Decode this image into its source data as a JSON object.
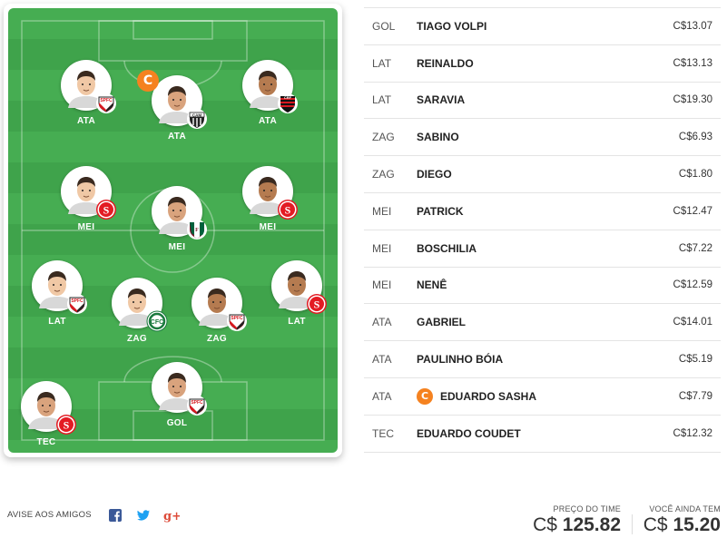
{
  "field": {
    "players": [
      {
        "id": "ata-left",
        "label": "ATA",
        "club": "spfc",
        "captain": false
      },
      {
        "id": "ata-center",
        "label": "ATA",
        "club": "cam",
        "captain": true,
        "captain_symbol": "C"
      },
      {
        "id": "ata-right",
        "label": "ATA",
        "club": "fla",
        "captain": false
      },
      {
        "id": "mei-left",
        "label": "MEI",
        "club": "inter",
        "captain": false
      },
      {
        "id": "mei-center",
        "label": "MEI",
        "club": "flu",
        "captain": false
      },
      {
        "id": "mei-right",
        "label": "MEI",
        "club": "inter",
        "captain": false
      },
      {
        "id": "lat-left",
        "label": "LAT",
        "club": "spfc",
        "captain": false
      },
      {
        "id": "zag-left",
        "label": "ZAG",
        "club": "cfc",
        "captain": false
      },
      {
        "id": "zag-right",
        "label": "ZAG",
        "club": "spfc",
        "captain": false
      },
      {
        "id": "lat-right",
        "label": "LAT",
        "club": "inter",
        "captain": false
      },
      {
        "id": "gol",
        "label": "GOL",
        "club": "spfc",
        "captain": false
      },
      {
        "id": "tec",
        "label": "TEC",
        "club": "inter",
        "captain": false
      }
    ]
  },
  "lineup": [
    {
      "pos": "GOL",
      "name": "TIAGO VOLPI",
      "price": "C$13.07"
    },
    {
      "pos": "LAT",
      "name": "REINALDO",
      "price": "C$13.13"
    },
    {
      "pos": "LAT",
      "name": "SARAVIA",
      "price": "C$19.30"
    },
    {
      "pos": "ZAG",
      "name": "SABINO",
      "price": "C$6.93"
    },
    {
      "pos": "ZAG",
      "name": "DIEGO",
      "price": "C$1.80"
    },
    {
      "pos": "MEI",
      "name": "PATRICK",
      "price": "C$12.47"
    },
    {
      "pos": "MEI",
      "name": "BOSCHILIA",
      "price": "C$7.22"
    },
    {
      "pos": "MEI",
      "name": "NENÊ",
      "price": "C$12.59"
    },
    {
      "pos": "ATA",
      "name": "GABRIEL",
      "price": "C$14.01"
    },
    {
      "pos": "ATA",
      "name": "PAULINHO BÓIA",
      "price": "C$5.19"
    },
    {
      "pos": "ATA",
      "name": "EDUARDO SASHA",
      "price": "C$7.79",
      "captain": true,
      "captain_symbol": "C"
    },
    {
      "pos": "TEC",
      "name": "EDUARDO COUDET",
      "price": "C$12.32"
    }
  ],
  "footer": {
    "share_label": "AVISE AOS AMIGOS",
    "share_icons": [
      "facebook-icon",
      "twitter-icon",
      "google-plus-icon"
    ],
    "team_price_label": "PREÇO DO TIME",
    "team_price_currency": "C$",
    "team_price_value": "125.82",
    "remaining_label": "VOCÊ AINDA TEM",
    "remaining_currency": "C$",
    "remaining_value": "15.20"
  },
  "colors": {
    "captain": "#f58220",
    "field_light": "#46ad52",
    "field_dark": "#3fa34b",
    "facebook": "#3b5998",
    "twitter": "#1da1f2",
    "google_plus": "#dd4b39"
  }
}
